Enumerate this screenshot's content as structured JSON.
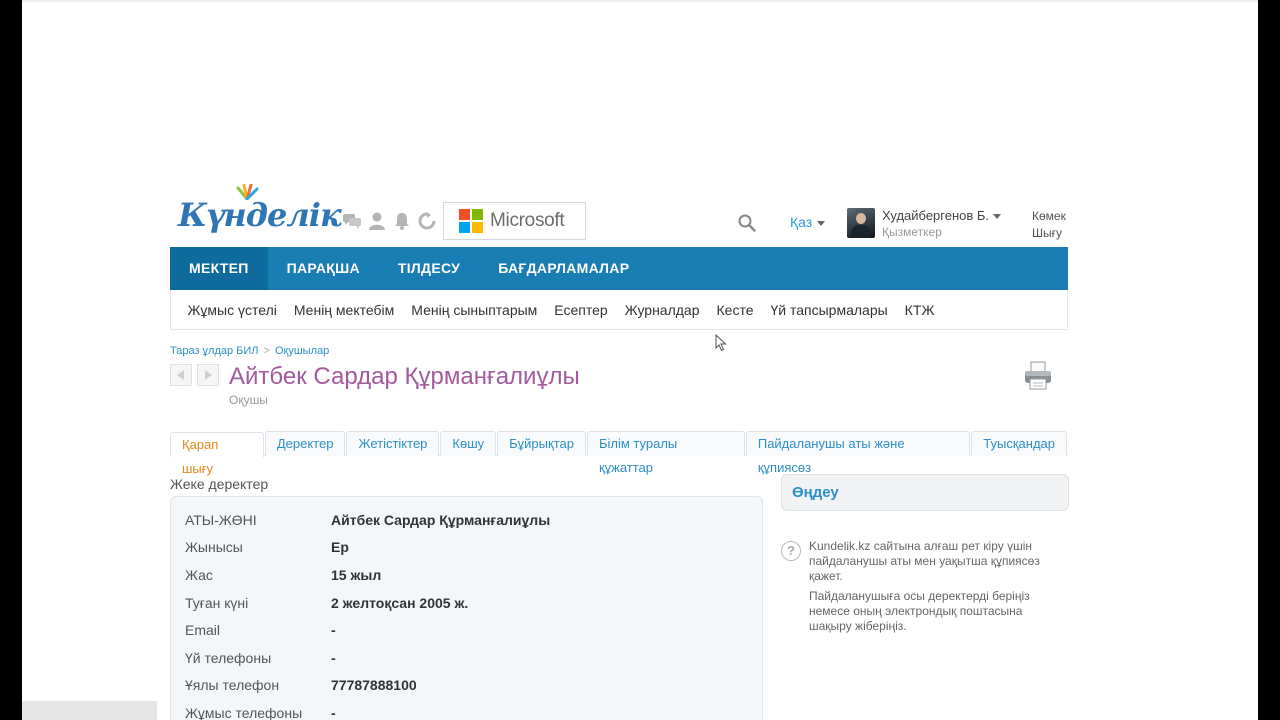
{
  "header": {
    "logo_text": "Күнделік",
    "brand_colors": {
      "primary": "#1a7db3",
      "active": "#0f6a9e",
      "title": "#a35a9e",
      "link": "#2d8fc8",
      "active_tab": "#e08a1c"
    },
    "icons": [
      "chat-icon",
      "user-icon",
      "bell-icon",
      "refresh-icon"
    ],
    "microsoft_label": "Microsoft",
    "language": "Қаз",
    "user_name": "Худайбергенов Б.",
    "user_role": "Қызметкер",
    "help_label": "Көмек",
    "logout_label": "Шығу"
  },
  "main_nav": {
    "items": [
      "МЕКТЕП",
      "ПАРАҚША",
      "ТІЛДЕСУ",
      "БАҒДАРЛАМАЛАР"
    ],
    "active": "МЕКТЕП"
  },
  "sub_nav": {
    "items": [
      "Жұмыс үстелі",
      "Менің мектебім",
      "Менің сыныптарым",
      "Есептер",
      "Журналдар",
      "Кесте",
      "Үй тапсырмалары",
      "КТЖ"
    ]
  },
  "breadcrumb": [
    "Тараз ұлдар БИЛ",
    "Оқушылар"
  ],
  "page": {
    "title": "Айтбек Сардар Құрманғалиұлы",
    "subtitle": "Оқушы"
  },
  "tabs": {
    "items": [
      "Қарап шығу",
      "Деректер",
      "Жетістіктер",
      "Көшу",
      "Бұйрықтар",
      "Білім туралы құжаттар",
      "Пайдаланушы аты және құпиясөз",
      "Туысқандар"
    ],
    "active": "Қарап шығу"
  },
  "personal": {
    "section_title": "Жеке деректер",
    "rows": [
      {
        "label": "АТЫ-ЖӨНІ",
        "value": "Айтбек Сардар Құрманғалиұлы"
      },
      {
        "label": "Жынысы",
        "value": "Ер"
      },
      {
        "label": "Жас",
        "value": "15 жыл"
      },
      {
        "label": "Туған күні",
        "value": "2 желтоқсан 2005 ж."
      },
      {
        "label": "Email",
        "value": "-"
      },
      {
        "label": "Үй телефоны",
        "value": "-"
      },
      {
        "label": "Ұялы телефон",
        "value": "77787888100"
      },
      {
        "label": "Жұмыс телефоны",
        "value": "-"
      }
    ]
  },
  "sidebar": {
    "edit_label": "Өңдеу",
    "info_1": "Kundelik.kz сайтына алғаш рет кіру үшін пайдаланушы аты мен уақытша құпиясөз қажет.",
    "info_2": "Пайдаланушыға осы деректерді беріңіз немесе оның электрондық поштасына шақыру жіберіңіз."
  }
}
